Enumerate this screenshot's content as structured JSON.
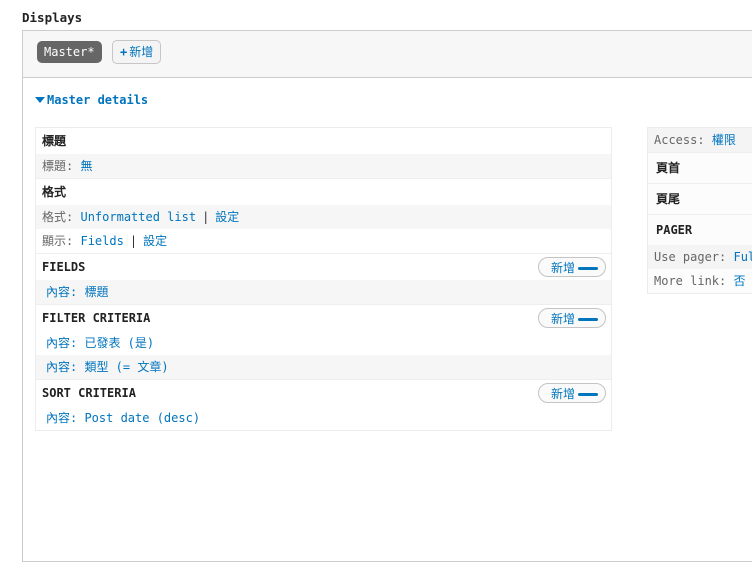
{
  "header": {
    "title": "Displays"
  },
  "tabs": {
    "master_label": "Master*",
    "add_label": "新增",
    "add_plus": "+"
  },
  "details": {
    "label": "Master details"
  },
  "left": {
    "title_section": {
      "heading": "標題",
      "row_label": "標題:",
      "row_value": "無"
    },
    "format_section": {
      "heading": "格式",
      "format_label": "格式:",
      "format_value": "Unformatted list",
      "format_sep": "|",
      "format_settings": "設定",
      "show_label": "顯示:",
      "show_value": "Fields",
      "show_sep": "|",
      "show_settings": "設定"
    },
    "fields": {
      "heading": "FIELDS",
      "add_label": "新增",
      "items": [
        "內容: 標題"
      ]
    },
    "filter": {
      "heading": "FILTER CRITERIA",
      "add_label": "新增",
      "items": [
        "內容: 已發表 (是)",
        "內容: 類型 (= 文章)"
      ]
    },
    "sort": {
      "heading": "SORT CRITERIA",
      "add_label": "新增",
      "items": [
        "內容: Post date (desc)"
      ]
    }
  },
  "right": {
    "access_label": "Access:",
    "access_value": "權限",
    "access_sep": "|",
    "header_heading": "頁首",
    "footer_heading": "頁尾",
    "pager_heading": "PAGER",
    "use_pager_label": "Use pager:",
    "use_pager_value": "Ful",
    "more_link_label": "More link:",
    "more_link_value": "否"
  },
  "colors": {
    "accent": "#0074bd",
    "tab_active_bg": "#666666"
  }
}
